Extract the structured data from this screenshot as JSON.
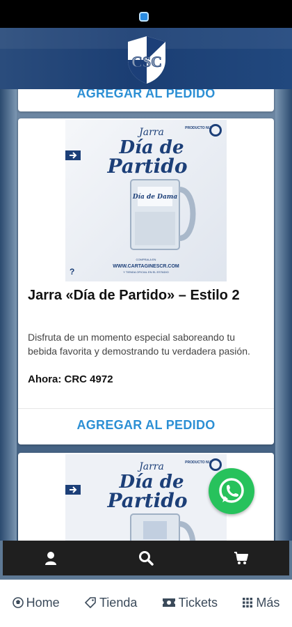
{
  "app": {
    "club_logo_text": "CSC"
  },
  "products": [
    {
      "order_label": "AGREGAR AL PEDIDO"
    },
    {
      "image": {
        "heading_line1": "Jarra",
        "heading_line2": "Día de",
        "heading_line3": "Partido",
        "badge": "PRODUCTO NUEVO",
        "mug_text": "Día de Dama",
        "website": "WWW.CARTAGINESCR.COM",
        "small_text": "Y TIENDA OFICIAL EN EL ESTADIO"
      },
      "title": "Jarra «Día de Partido» – Estilo 2",
      "description": "Disfruta de un momento especial saboreando tu bebida favorita y demostrando tu verdadera pasión.",
      "price": "Ahora: CRC 4972",
      "order_label": "AGREGAR AL PEDIDO"
    },
    {
      "image": {
        "heading_line1": "Jarra",
        "heading_line2": "Día de",
        "heading_line3": "Partido",
        "badge": "PRODUCTO NUEVO"
      }
    }
  ],
  "icon_bar": {
    "icons": [
      "user-icon",
      "search-icon",
      "cart-icon"
    ]
  },
  "bottom_nav": {
    "home": "Home",
    "tienda": "Tienda",
    "tickets": "Tickets",
    "mas": "Más"
  },
  "colors": {
    "accent": "#2c8fd4",
    "header": "#1b3e73",
    "whatsapp": "#27c25c"
  }
}
